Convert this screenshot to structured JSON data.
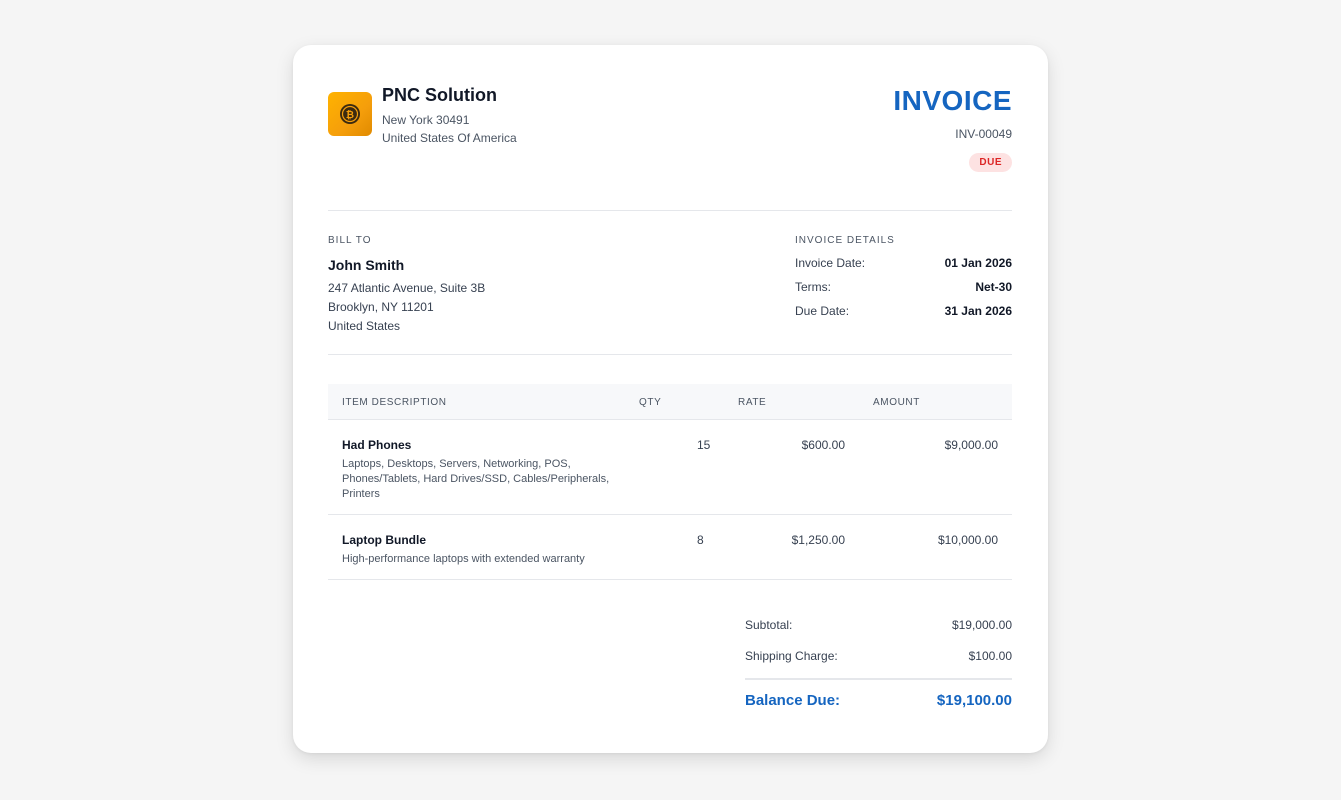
{
  "company": {
    "name": "PNC Solution",
    "address_line1": "New York 30491",
    "address_line2": "United States Of America",
    "logo_icon": "bitcoin-coin-icon",
    "logo_color": "#f59e0b"
  },
  "invoice": {
    "title": "INVOICE",
    "number": "INV-00049",
    "status": "DUE",
    "accent_color": "#1565c0",
    "status_color": "#dc2626"
  },
  "bill_to": {
    "label": "BILL TO",
    "name": "John Smith",
    "line1": "247 Atlantic Avenue, Suite 3B",
    "line2": "Brooklyn, NY 11201",
    "line3": "United States"
  },
  "details": {
    "label": "INVOICE DETAILS",
    "rows": [
      {
        "label": "Invoice Date:",
        "value": "01 Jan 2026"
      },
      {
        "label": "Terms:",
        "value": "Net-30"
      },
      {
        "label": "Due Date:",
        "value": "31 Jan 2026"
      }
    ]
  },
  "table": {
    "headers": [
      "ITEM DESCRIPTION",
      "QTY",
      "RATE",
      "AMOUNT"
    ],
    "items": [
      {
        "title": "Had Phones",
        "description": "Laptops, Desktops, Servers, Networking, POS, Phones/Tablets, Hard Drives/SSD, Cables/Peripherals, Printers",
        "qty": "15",
        "rate": "$600.00",
        "amount": "$9,000.00"
      },
      {
        "title": "Laptop Bundle",
        "description": "High-performance laptops with extended warranty",
        "qty": "8",
        "rate": "$1,250.00",
        "amount": "$10,000.00"
      }
    ]
  },
  "totals": {
    "subtotal_label": "Subtotal:",
    "subtotal_value": "$19,000.00",
    "shipping_label": "Shipping Charge:",
    "shipping_value": "$100.00",
    "balance_label": "Balance Due:",
    "balance_value": "$19,100.00"
  }
}
